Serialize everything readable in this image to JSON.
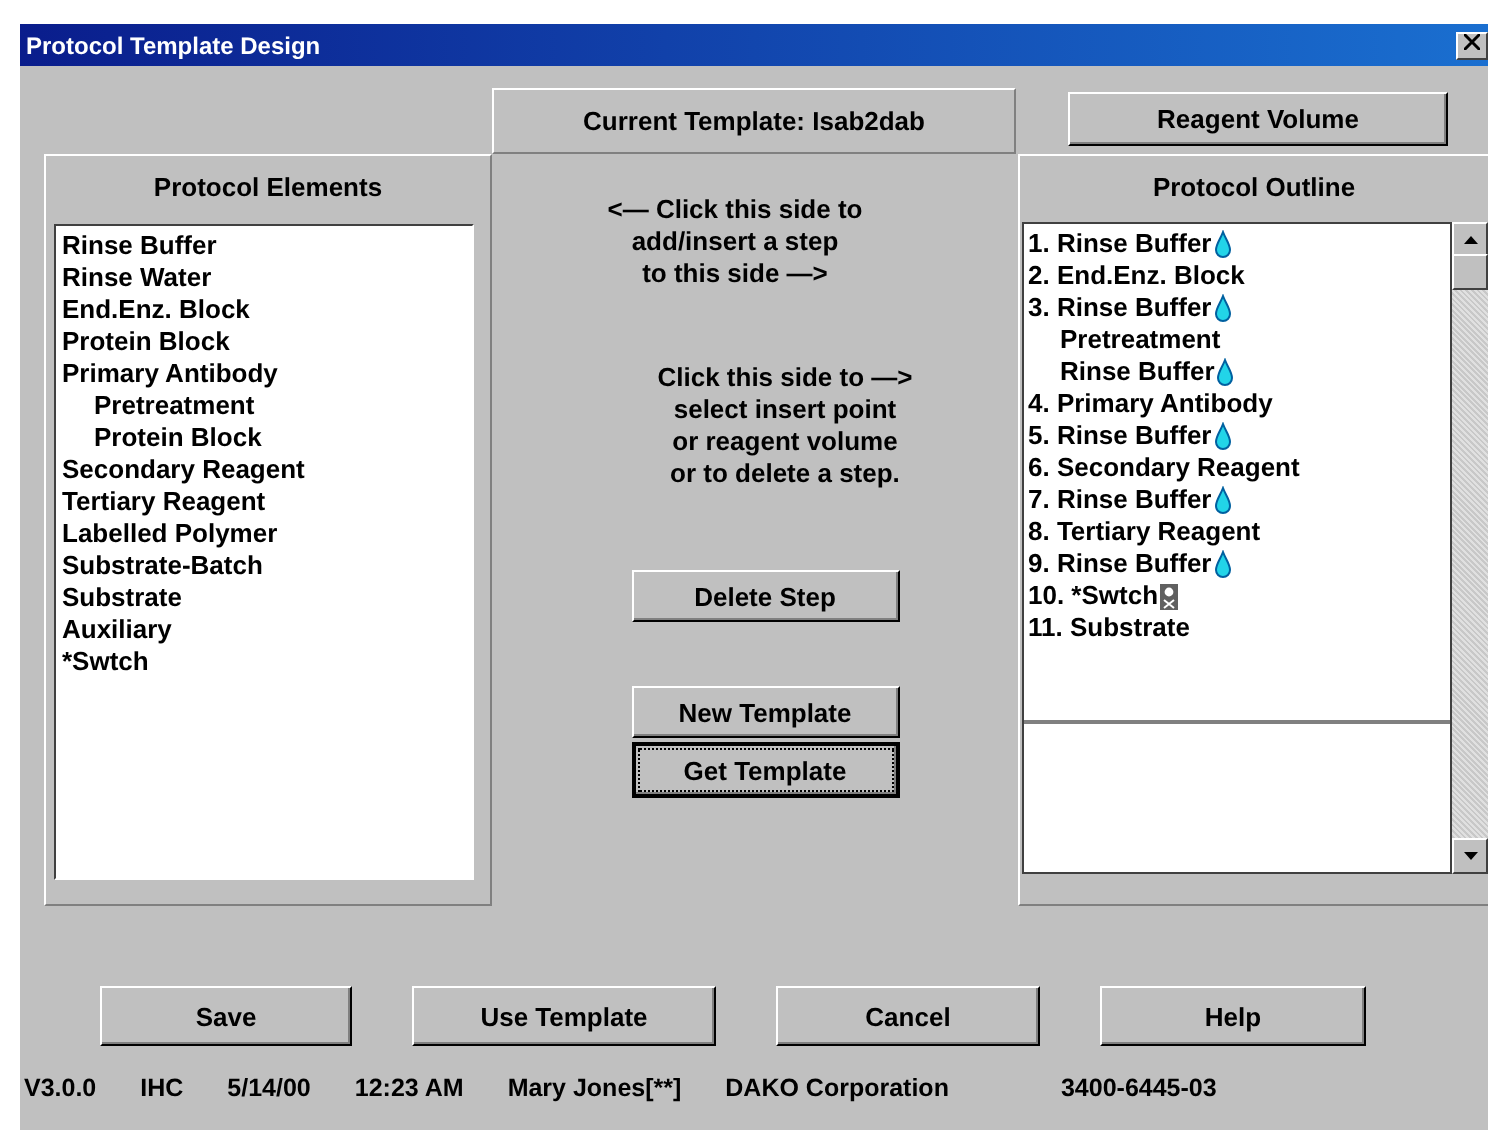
{
  "window": {
    "title": "Protocol Template Design"
  },
  "current_template": "Current Template: Isab2dab",
  "reagent_volume_button": "Reagent Volume",
  "elements_panel": {
    "title": "Protocol Elements",
    "items": [
      {
        "label": "Rinse Buffer"
      },
      {
        "label": "Rinse Water"
      },
      {
        "label": "End.Enz. Block"
      },
      {
        "label": "Protein Block"
      },
      {
        "label": "Primary Antibody",
        "children": [
          {
            "label": "Pretreatment"
          },
          {
            "label": "Protein Block"
          }
        ]
      },
      {
        "label": "Secondary Reagent"
      },
      {
        "label": "Tertiary Reagent"
      },
      {
        "label": "Labelled Polymer"
      },
      {
        "label": "Substrate-Batch"
      },
      {
        "label": "Substrate"
      },
      {
        "label": "Auxiliary"
      },
      {
        "label": "*Swtch"
      }
    ]
  },
  "instructions": [
    [
      "<— Click this side to",
      "add/insert a step",
      "to this side —>"
    ],
    [
      "Click this side to —>",
      "select insert point",
      "or reagent volume",
      "or to delete a step."
    ]
  ],
  "middle_buttons": [
    {
      "label": "Delete Step",
      "focused": false
    },
    {
      "label": "New Template",
      "focused": false
    },
    {
      "label": "Get Template",
      "focused": true
    }
  ],
  "outline_panel": {
    "title": "Protocol Outline",
    "items": [
      {
        "label": "1. Rinse Buffer",
        "kind": "rinse"
      },
      {
        "label": "2. End.Enz. Block",
        "kind": "step"
      },
      {
        "label": "3. Rinse Buffer",
        "kind": "rinse",
        "children": [
          {
            "label": "Pretreatment",
            "kind": "step"
          },
          {
            "label": "Rinse Buffer",
            "kind": "rinse"
          }
        ]
      },
      {
        "label": "4. Primary Antibody",
        "kind": "step"
      },
      {
        "label": "5. Rinse Buffer",
        "kind": "rinse"
      },
      {
        "label": "6. Secondary Reagent",
        "kind": "step"
      },
      {
        "label": "7. Rinse Buffer",
        "kind": "rinse"
      },
      {
        "label": "8. Tertiary Reagent",
        "kind": "step"
      },
      {
        "label": "9. Rinse Buffer",
        "kind": "rinse"
      },
      {
        "label": "10. *Swtch",
        "kind": "switch"
      },
      {
        "label": "11. Substrate",
        "kind": "step"
      }
    ]
  },
  "bottom_buttons": [
    "Save",
    "Use Template",
    "Cancel",
    "Help"
  ],
  "status_bar": [
    "V3.0.0",
    "IHC",
    "5/14/00",
    "12:23 AM",
    "Mary Jones[**]",
    "DAKO Corporation",
    "3400-6445-03"
  ]
}
